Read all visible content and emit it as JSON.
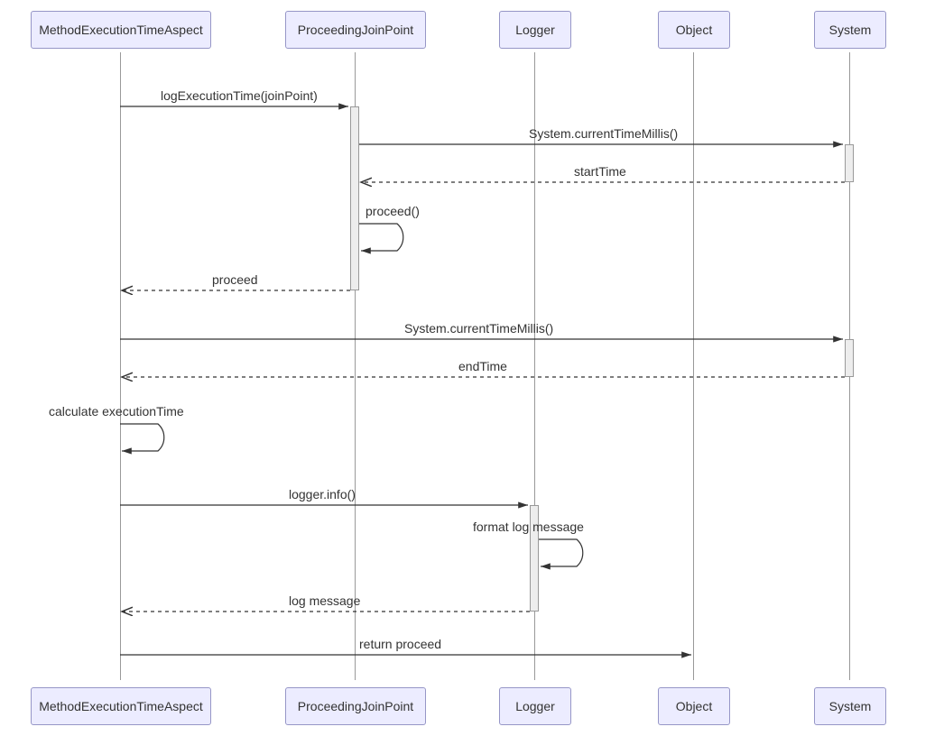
{
  "actors": {
    "a1": "MethodExecutionTimeAspect",
    "a2": "ProceedingJoinPoint",
    "a3": "Logger",
    "a4": "Object",
    "a5": "System"
  },
  "messages": {
    "m1": "logExecutionTime(joinPoint)",
    "m2": "System.currentTimeMillis()",
    "m3": "startTime",
    "m4": "proceed()",
    "m5": "proceed",
    "m6": "System.currentTimeMillis()",
    "m7": "endTime",
    "m8": "calculate executionTime",
    "m9": "logger.info()",
    "m10": "format log message",
    "m11": "log message",
    "m12": "return proceed"
  },
  "chart_data": {
    "type": "sequence-diagram",
    "participants": [
      "MethodExecutionTimeAspect",
      "ProceedingJoinPoint",
      "Logger",
      "Object",
      "System"
    ],
    "interactions": [
      {
        "from": "MethodExecutionTimeAspect",
        "to": "ProceedingJoinPoint",
        "label": "logExecutionTime(joinPoint)",
        "style": "solid",
        "activates": "ProceedingJoinPoint"
      },
      {
        "from": "ProceedingJoinPoint",
        "to": "System",
        "label": "System.currentTimeMillis()",
        "style": "solid",
        "activates": "System"
      },
      {
        "from": "System",
        "to": "ProceedingJoinPoint",
        "label": "startTime",
        "style": "dashed",
        "deactivates": "System"
      },
      {
        "from": "ProceedingJoinPoint",
        "to": "ProceedingJoinPoint",
        "label": "proceed()",
        "style": "solid",
        "self": true
      },
      {
        "from": "ProceedingJoinPoint",
        "to": "MethodExecutionTimeAspect",
        "label": "proceed",
        "style": "dashed",
        "deactivates": "ProceedingJoinPoint"
      },
      {
        "from": "MethodExecutionTimeAspect",
        "to": "System",
        "label": "System.currentTimeMillis()",
        "style": "solid",
        "activates": "System"
      },
      {
        "from": "System",
        "to": "MethodExecutionTimeAspect",
        "label": "endTime",
        "style": "dashed",
        "deactivates": "System"
      },
      {
        "from": "MethodExecutionTimeAspect",
        "to": "MethodExecutionTimeAspect",
        "label": "calculate executionTime",
        "style": "solid",
        "self": true
      },
      {
        "from": "MethodExecutionTimeAspect",
        "to": "Logger",
        "label": "logger.info()",
        "style": "solid",
        "activates": "Logger"
      },
      {
        "from": "Logger",
        "to": "Logger",
        "label": "format log message",
        "style": "solid",
        "self": true
      },
      {
        "from": "Logger",
        "to": "MethodExecutionTimeAspect",
        "label": "log message",
        "style": "dashed",
        "deactivates": "Logger"
      },
      {
        "from": "MethodExecutionTimeAspect",
        "to": "Object",
        "label": "return proceed",
        "style": "solid"
      }
    ]
  }
}
